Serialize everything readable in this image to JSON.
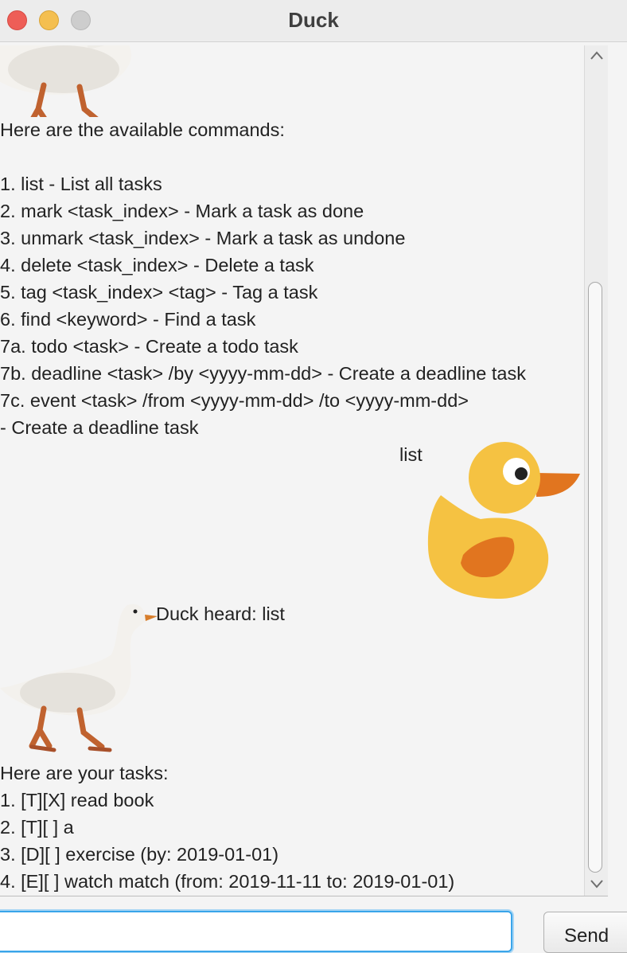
{
  "window": {
    "title": "Duck"
  },
  "dialog": {
    "help_text": "Here are the available commands:\n\n1. list - List all tasks\n2. mark <task_index> - Mark a task as done\n3. unmark <task_index> - Mark a task as undone\n4. delete <task_index> - Delete a task\n5. tag <task_index> <tag> - Tag a task\n6. find <keyword> - Find a task\n7a. todo <task> - Create a todo task\n7b. deadline <task> /by <yyyy-mm-dd> - Create a deadline task\n7c. event <task> /from <yyyy-mm-dd> /to <yyyy-mm-dd>\n- Create a deadline task",
    "user_message": "list",
    "duck_heard": "Duck heard: list",
    "tasks_text": "Here are your tasks:\n1. [T][X] read book\n2. [T][ ] a\n3. [D][ ] exercise (by: 2019-01-01)\n4. [E][ ] watch match (from: 2019-11-11 to: 2019-01-01)"
  },
  "input": {
    "value": ""
  },
  "send_button": {
    "label": "Send"
  },
  "icons": {
    "bot_avatar": "goose-image",
    "user_avatar": "rubber-duck-image"
  },
  "colors": {
    "duck_body": "#f5c242",
    "duck_beak": "#e1751f",
    "focus_ring": "#39a5ea"
  }
}
